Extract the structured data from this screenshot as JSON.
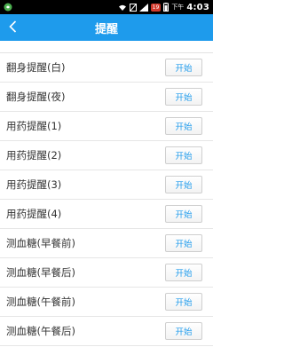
{
  "status_bar": {
    "time": "4:03",
    "ampm": "下午",
    "notification_badge": "19",
    "icons": [
      "app-notification-icon",
      "wifi-icon",
      "mute-icon",
      "signal-icon",
      "battery-icon"
    ]
  },
  "header": {
    "title": "提醒",
    "back_icon": "chevron-left-icon",
    "background_color": "#1e9bec"
  },
  "reminders": [
    {
      "label": "翻身提醒(白)",
      "button": "开始"
    },
    {
      "label": "翻身提醒(夜)",
      "button": "开始"
    },
    {
      "label": "用药提醒(1)",
      "button": "开始"
    },
    {
      "label": "用药提醒(2)",
      "button": "开始"
    },
    {
      "label": "用药提醒(3)",
      "button": "开始"
    },
    {
      "label": "用药提醒(4)",
      "button": "开始"
    },
    {
      "label": "测血糖(早餐前)",
      "button": "开始"
    },
    {
      "label": "测血糖(早餐后)",
      "button": "开始"
    },
    {
      "label": "测血糖(午餐前)",
      "button": "开始"
    },
    {
      "label": "测血糖(午餐后)",
      "button": "开始"
    }
  ]
}
